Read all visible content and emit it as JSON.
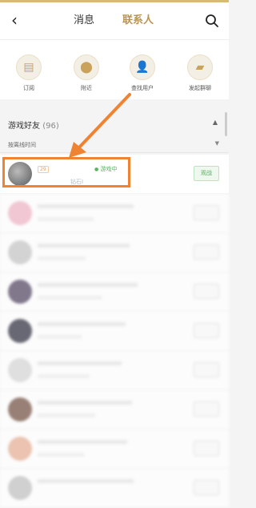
{
  "header": {
    "tabs": [
      {
        "label": "消息"
      },
      {
        "label": "联系人"
      }
    ]
  },
  "actions": [
    {
      "label": "订阅",
      "icon": "subscribe-icon"
    },
    {
      "label": "附近",
      "icon": "location-pin-icon"
    },
    {
      "label": "查找用户",
      "icon": "add-user-icon"
    },
    {
      "label": "发起群聊",
      "icon": "group-chat-icon"
    }
  ],
  "friends": {
    "title": "游戏好友",
    "count": "(96)",
    "sort_label": "按离线时间"
  },
  "rows": [
    {
      "level": "29",
      "name": "",
      "status": "游戏中",
      "sub": "钻石I",
      "button": "观战"
    }
  ],
  "colors": {
    "accent": "#b89556",
    "highlight": "#f08332",
    "online": "#58b35a"
  }
}
